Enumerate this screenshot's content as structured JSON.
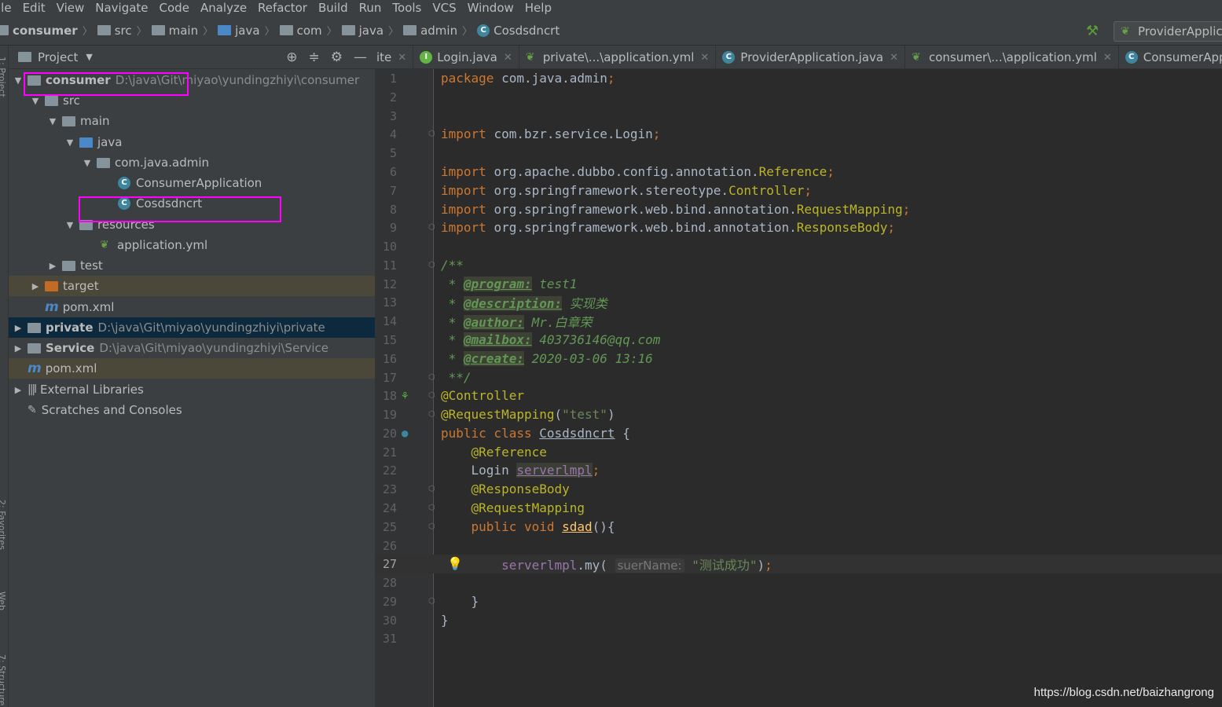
{
  "menu": [
    "ile",
    "Edit",
    "View",
    "Navigate",
    "Code",
    "Analyze",
    "Refactor",
    "Build",
    "Run",
    "Tools",
    "VCS",
    "Window",
    "Help"
  ],
  "breadcrumb": [
    "consumer",
    "src",
    "main",
    "java",
    "com",
    "java",
    "admin",
    "Cosdsdncrt"
  ],
  "run_config": "ProviderApplic",
  "project_panel": {
    "title": "Project",
    "tree": [
      {
        "label": "consumer",
        "path": "D:\\java\\Git\\miyao\\yundingzhiyi\\consumer"
      },
      {
        "label": "src"
      },
      {
        "label": "main"
      },
      {
        "label": "java"
      },
      {
        "label": "com.java.admin"
      },
      {
        "label": "ConsumerApplication"
      },
      {
        "label": "Cosdsdncrt"
      },
      {
        "label": "resources"
      },
      {
        "label": "application.yml"
      },
      {
        "label": "test"
      },
      {
        "label": "target"
      },
      {
        "label": "pom.xml"
      },
      {
        "label": "private",
        "path": "D:\\java\\Git\\miyao\\yundingzhiyi\\private"
      },
      {
        "label": "Service",
        "path": "D:\\java\\Git\\miyao\\yundingzhiyi\\Service"
      },
      {
        "label": "pom.xml"
      },
      {
        "label": "External Libraries"
      },
      {
        "label": "Scratches and Consoles"
      }
    ]
  },
  "side_strip": {
    "project": "1: Project",
    "favorites": "2: Favorites",
    "web": "Web",
    "structure": "7: Structure"
  },
  "tabs": [
    "ite",
    "Login.java",
    "private\\...\\application.yml",
    "ProviderApplication.java",
    "consumer\\...\\application.yml",
    "ConsumerAppl"
  ],
  "editor": {
    "line_numbers": [
      "1",
      "2",
      "3",
      "4",
      "5",
      "6",
      "7",
      "8",
      "9",
      "10",
      "11",
      "12",
      "13",
      "14",
      "15",
      "16",
      "17",
      "18",
      "19",
      "20",
      "21",
      "22",
      "23",
      "24",
      "25",
      "26",
      "27",
      "28",
      "29",
      "30",
      "31"
    ],
    "pkg": "com.java.admin",
    "imports": [
      {
        "pkg": "com.bzr.service.",
        "cls": "Login"
      },
      {
        "pkg": "org.apache.dubbo.config.annotation.",
        "cls": "Reference"
      },
      {
        "pkg": "org.springframework.stereotype.",
        "cls": "Controller"
      },
      {
        "pkg": "org.springframework.web.bind.annotation.",
        "cls": "RequestMapping"
      },
      {
        "pkg": "org.springframework.web.bind.annotation.",
        "cls": "ResponseBody"
      }
    ],
    "doc": {
      "program_tag": "@program:",
      "program": " test1",
      "description_tag": "@description:",
      "description": " 实现类",
      "author_tag": "@author:",
      "author": " Mr.白章荣",
      "mailbox_tag": "@mailbox:",
      "mailbox": " 403736146@qq.com",
      "create_tag": "@create:",
      "create": " 2020-03-06 13:16"
    },
    "class_name": "Cosdsdncrt",
    "mapping_value": "\"test\"",
    "field_type": "Login",
    "field_name": "serverlmpl",
    "method_name": "sdad",
    "call_target": "serverlmpl",
    "call_method": "my",
    "param_hint": "suerName:",
    "call_arg": "\"测试成功\""
  },
  "watermark": "https://blog.csdn.net/baizhangrong",
  "colors": {
    "highlight_box": "#ff00ff",
    "keyword": "#cc7832",
    "annotation": "#bbb529",
    "doc_comment": "#629755"
  }
}
